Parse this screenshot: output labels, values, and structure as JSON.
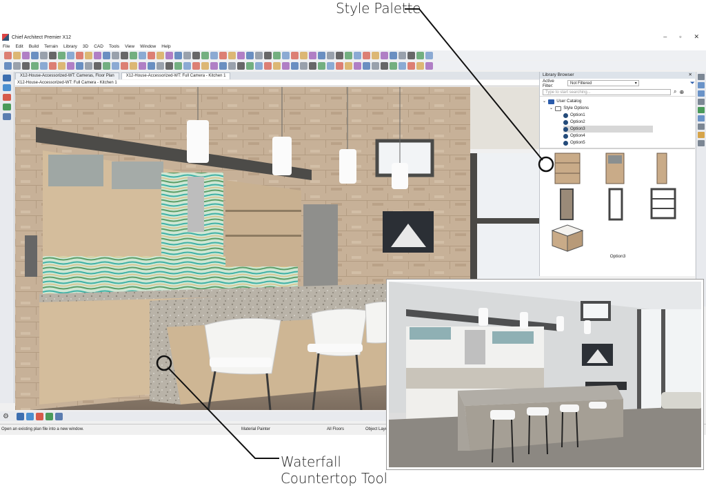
{
  "callouts": {
    "style_palette": "Style Palette",
    "waterfall_line1": "Waterfall",
    "waterfall_line2": "Countertop Tool"
  },
  "app": {
    "title": "Chief Architect Premier X12",
    "window_controls": [
      "–",
      "▫",
      "✕"
    ],
    "menu": [
      "File",
      "Edit",
      "Build",
      "Terrain",
      "Library",
      "3D",
      "CAD",
      "Tools",
      "View",
      "Window",
      "Help"
    ],
    "tabs": [
      {
        "label": "X12-House-Accessorized-WT: Cameras, Floor Plan",
        "active": false
      },
      {
        "label": "X12-House-Accessorized-WT: Full Camera - Kitchen 1",
        "active": true
      }
    ],
    "view_title": "X12-House-Accessorized-WT: Full Camera - Kitchen 1",
    "toolbar_counter": "1"
  },
  "library": {
    "header": "Library Browser",
    "filter_label": "Active Filter:",
    "filter_value": "Not Filtered",
    "search_placeholder": "Type to start searching...",
    "tree": [
      {
        "label": "User Catalog",
        "kind": "folder",
        "selected": false
      },
      {
        "label": "Style Options",
        "kind": "folder-open",
        "selected": false
      },
      {
        "label": "Option1",
        "kind": "item",
        "selected": false
      },
      {
        "label": "Option2",
        "kind": "item",
        "selected": false
      },
      {
        "label": "Option3",
        "kind": "item",
        "selected": true
      },
      {
        "label": "Option4",
        "kind": "item",
        "selected": false
      },
      {
        "label": "Option5",
        "kind": "item",
        "selected": false
      }
    ],
    "preview_caption": "Option3"
  },
  "status": {
    "message": "Open an existing plan file into a new window.",
    "mode": "Material Painter",
    "floors": "All Floors",
    "layer": "Object Laye"
  },
  "icons": [
    "gear-icon",
    "close-icon",
    "filter-icon",
    "search-icon",
    "zoom-icon"
  ],
  "colors": {
    "accent": "#2a5bab",
    "wall_wood": "#c8b297",
    "cabinet": "#d2bc9c",
    "backsplash": "#69c5b8"
  }
}
